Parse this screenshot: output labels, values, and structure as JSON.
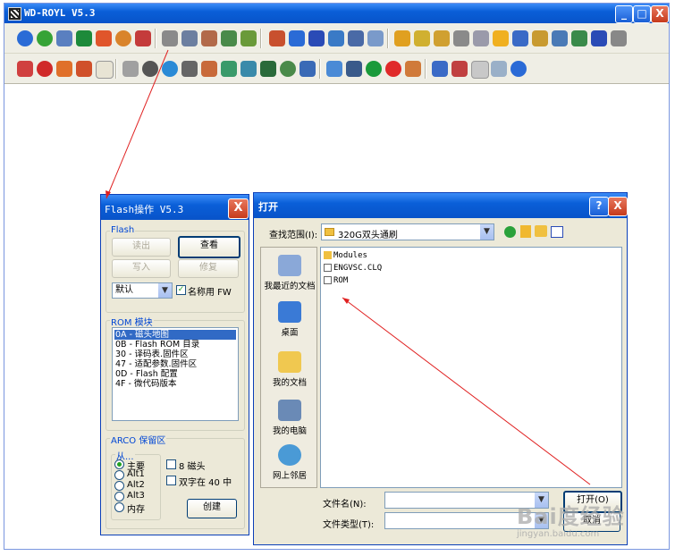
{
  "main": {
    "title": "WD-ROYL V5.3",
    "minimize": "_",
    "maximize": "□",
    "close": "X"
  },
  "flash_dialog": {
    "title": "Flash操作 V5.3",
    "close": "X",
    "flash_group": "Flash",
    "read_button": "读出",
    "view_button": "查看",
    "write_button": "写入",
    "repair_button": "修复",
    "default_select": "默认",
    "name_fw_checkbox": "名称用 FW",
    "rom_group": "ROM 模块",
    "rom_items": [
      "0A - 磁头地图",
      "0B - Flash ROM 目录",
      "30 - 译码表.固件区",
      "47 - 适配参数.固件区",
      "0D - Flash 配置",
      "4F - 微代码版本"
    ],
    "arco_group": "ARCO 保留区",
    "from_group": "从...",
    "source_options": [
      "主要",
      "Alt1",
      "Alt2",
      "Alt3",
      "内存"
    ],
    "eight_heads": "8 磁头",
    "double_word": "双字在 40 中",
    "create_button": "创建"
  },
  "open_dialog": {
    "title": "打开",
    "help": "?",
    "close": "X",
    "lookin_label": "查找范围(I):",
    "lookin_value": "320G双头通刷",
    "places": [
      "我最近的文档",
      "桌面",
      "我的文档",
      "我的电脑",
      "网上邻居"
    ],
    "files": [
      "Modules",
      "ENGVSC.CLQ",
      "ROM"
    ],
    "filename_label": "文件名(N):",
    "filetype_label": "文件类型(T):",
    "open_button": "打开(O)",
    "cancel_button": "取消"
  },
  "watermark": {
    "logo": "Bai度经验",
    "url": "jingyan.baidu.com"
  },
  "colors": {
    "titlebar": "#0a5fd8",
    "dialog_bg": "#ece9d8",
    "selection": "#316ac5",
    "arrow": "#e02020"
  }
}
